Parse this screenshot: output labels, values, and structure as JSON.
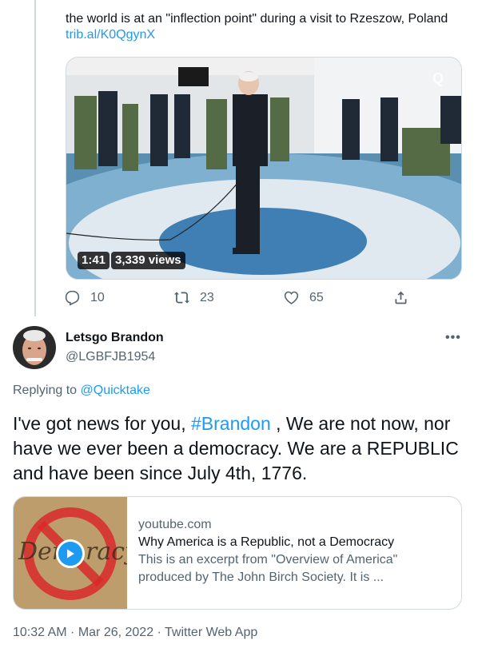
{
  "quoted_tweet": {
    "text": "the world is at an \"inflection point\" during a visit to Rzeszow, Poland ",
    "link": "trib.al/K0QgynX",
    "video": {
      "duration": "1:41",
      "views": "3,339 views",
      "brand_mark": "Q"
    },
    "actions": {
      "replies": "10",
      "retweets": "23",
      "likes": "65"
    }
  },
  "tweet": {
    "display_name": "Letsgo Brandon",
    "handle": "@LGBFJB1954",
    "more": "•••",
    "replying_prefix": "Replying to ",
    "replying_to": "@Quicktake",
    "text_before": "I've got news for you, ",
    "hashtag": "#Brandon",
    "text_after": " , We are not now, nor have we ever been a democracy. We are a REPUBLIC and have been since July 4th, 1776.",
    "card": {
      "domain": "youtube.com",
      "title": "Why America is a Republic, not a Democracy",
      "description": "This is an excerpt from \"Overview of America\" produced by The John Birch Society. It is ..."
    },
    "timestamp": "10:32 AM · Mar 26, 2022 · Twitter Web App"
  },
  "colors": {
    "accent": "#1d9bf0",
    "secondary_text": "#536471",
    "border": "#cfd9de"
  },
  "icons": [
    "reply-icon",
    "retweet-icon",
    "like-icon",
    "share-icon",
    "play-icon",
    "more-icon"
  ]
}
